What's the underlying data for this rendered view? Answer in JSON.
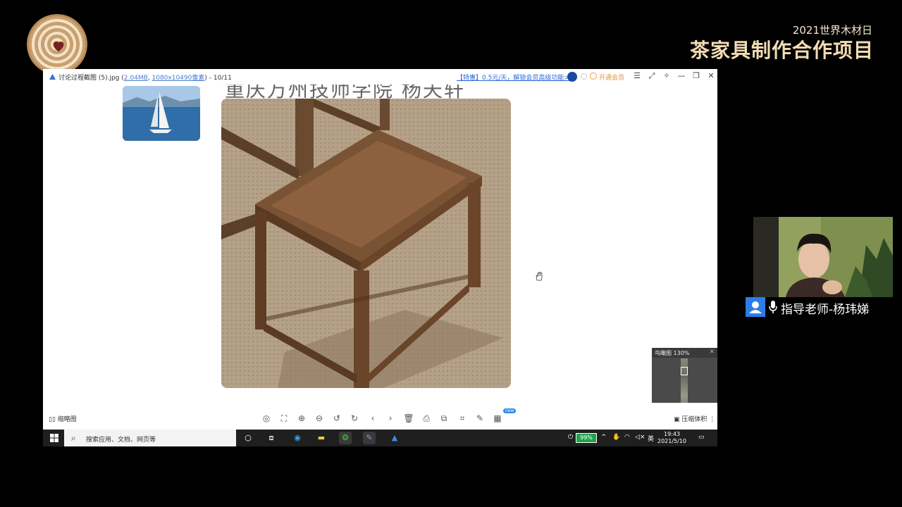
{
  "event": {
    "subtitle": "2021世界木材日",
    "title": "茶家具制作合作项目"
  },
  "viewer": {
    "filename_prefix": "讨论过程截图 (5).jpg (",
    "file_size": "2.04MB",
    "separator": ", ",
    "dimensions": "1080x10490像素",
    "page_counter": ") - 10/11",
    "promo": "【特惠】0.5元/天，解锁会员高级功能>",
    "vip_label": "开通会员",
    "stage_caption": "重庆万州技师学院 杨天轩",
    "birdseye_label": "鸟瞰图 130%",
    "thumbnails_label": "缩略图",
    "new_badge": "new",
    "compress_label": "压缩体积"
  },
  "taskbar": {
    "search_placeholder": "搜索应用、文档、网页等",
    "battery": "99%",
    "ime": "英",
    "time": "19:43",
    "date": "2021/5/10"
  },
  "presenter": {
    "name": "指导老师-杨玮娣"
  },
  "colors": {
    "event_title": "#f2dcb4",
    "promo_link": "#2a66d8",
    "vip": "#e8922c",
    "battery": "#1fa34a",
    "presenter_badge": "#2b7de9"
  }
}
